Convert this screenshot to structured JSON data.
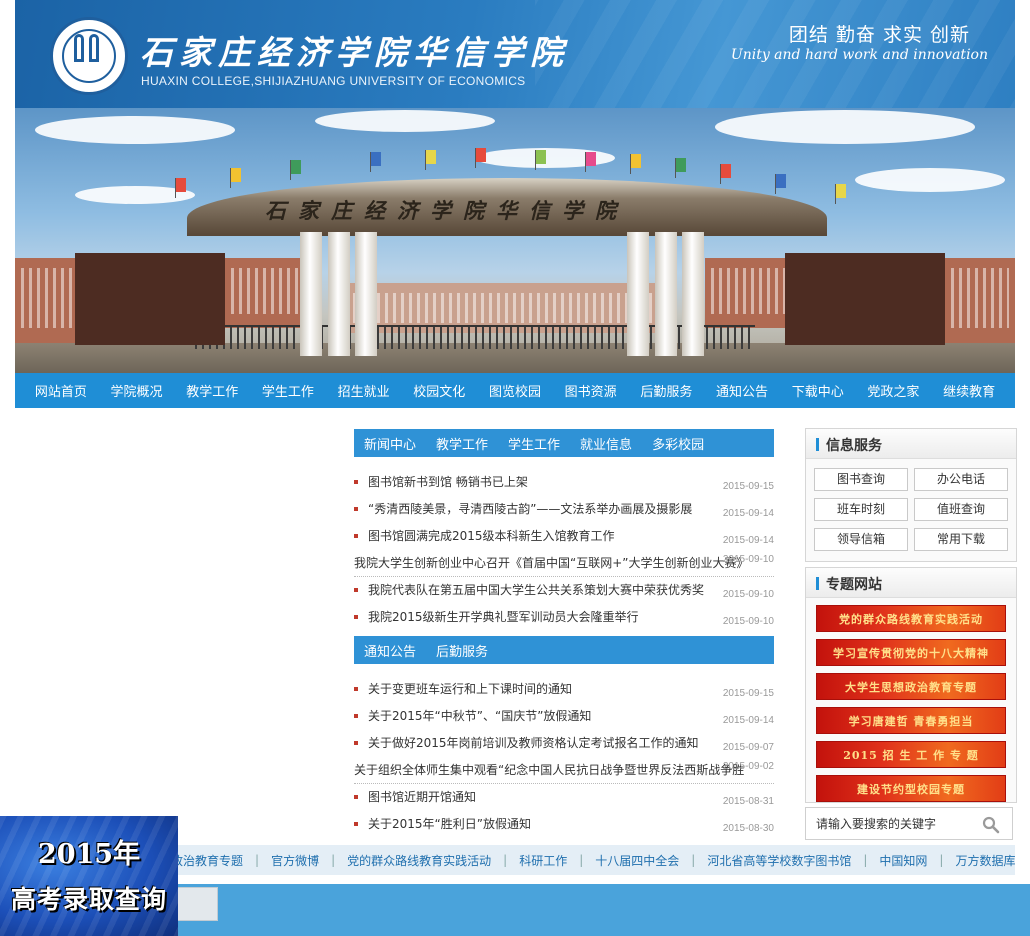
{
  "header": {
    "college_name_cn": "石家庄经济学院华信学院",
    "college_name_en": "HUAXIN COLLEGE,SHIJIAZHUANG UNIVERSITY OF ECONOMICS",
    "motto_cn": "团结 勤奋 求实 创新",
    "motto_en": "Unity and hard work and innovation"
  },
  "banner": {
    "gate_text": "石家庄经济学院华信学院"
  },
  "nav": {
    "items": [
      "网站首页",
      "学院概况",
      "教学工作",
      "学生工作",
      "招生就业",
      "校园文化",
      "图览校园",
      "图书资源",
      "后勤服务",
      "通知公告",
      "下载中心",
      "党政之家",
      "继续教育"
    ]
  },
  "news": {
    "tabs": [
      "新闻中心",
      "教学工作",
      "学生工作",
      "就业信息",
      "多彩校园"
    ],
    "items": [
      {
        "title": "图书馆新书到馆 畅销书已上架",
        "date": "2015-09-15"
      },
      {
        "title": "“秀清西陵美景，寻清西陵古韵”——文法系举办画展及摄影展",
        "date": "2015-09-14"
      },
      {
        "title": "图书馆圆满完成2015级本科新生入馆教育工作",
        "date": "2015-09-14"
      },
      {
        "title": "我院大学生创新创业中心召开《首届中国“互联网+”大学生创新创业大赛》",
        "date": "2015-09-10"
      },
      {
        "title": "我院代表队在第五届中国大学生公共关系策划大赛中荣获优秀奖",
        "date": "2015-09-10"
      },
      {
        "title": "我院2015级新生开学典礼暨军训动员大会隆重举行",
        "date": "2015-09-10"
      }
    ]
  },
  "notices": {
    "tabs": [
      "通知公告",
      "后勤服务"
    ],
    "items": [
      {
        "title": "关于变更班车运行和上下课时间的通知",
        "date": "2015-09-15"
      },
      {
        "title": "关于2015年“中秋节”、“国庆节”放假通知",
        "date": "2015-09-14"
      },
      {
        "title": "关于做好2015年岗前培训及教师资格认定考试报名工作的通知",
        "date": "2015-09-07"
      },
      {
        "title": "关于组织全体师生集中观看“纪念中国人民抗日战争暨世界反法西斯战争胜",
        "date": "2015-09-02"
      },
      {
        "title": "图书馆近期开馆通知",
        "date": "2015-08-31"
      },
      {
        "title": "关于2015年“胜利日”放假通知",
        "date": "2015-08-30"
      }
    ]
  },
  "info_services": {
    "title": "信息服务",
    "buttons": [
      "图书查询",
      "办公电话",
      "班车时刻",
      "值班查询",
      "领导信箱",
      "常用下载"
    ]
  },
  "topic_sites": {
    "title": "专题网站",
    "items": [
      "党的群众路线教育实践活动",
      "学习宣传贯彻党的十八大精神",
      "大学生思想政治教育专题",
      "学习唐建哲 青春勇担当",
      "2015 招 生 工 作 专 题",
      "建设节约型校园专题"
    ]
  },
  "search": {
    "placeholder": "请输入要搜索的关键字"
  },
  "links": {
    "items": [
      "政治教育专题",
      "官方微博",
      "党的群众路线教育实践活动",
      "科研工作",
      "十八届四中全会",
      "河北省高等学校数字图书馆",
      "中国知网",
      "万方数据库"
    ]
  },
  "float_ad": {
    "line1": "2015年",
    "line2": "高考录取查询"
  },
  "colors": {
    "header_blue": "#2a7cc0",
    "nav_blue": "#1f8ed6",
    "topic_red": "#d8261a",
    "footer_blue": "#4aa3db"
  }
}
